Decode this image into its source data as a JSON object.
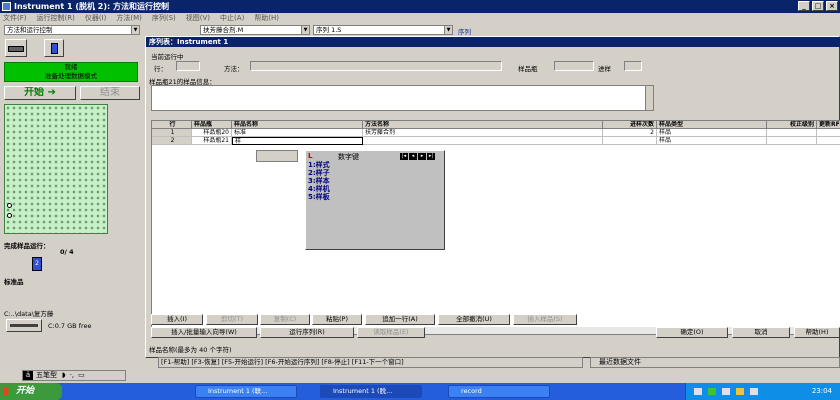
{
  "window": {
    "title": "Instrument 1 (脱机 2): 方法和运行控制",
    "controls": [
      "_",
      "□",
      "×"
    ]
  },
  "menu": [
    "文件(F)",
    "运行控制(R)",
    "仪器(I)",
    "方法(M)",
    "序列(S)",
    "视图(V)",
    "中止(A)",
    "帮助(H)"
  ],
  "toolbar": {
    "mode_select": "方法和运行控制",
    "method_select": "扶芳藤合剂.M",
    "sequence_select": "序列 1.S",
    "sequence_label": "序列"
  },
  "left_panel": {
    "status_line1": "就绪",
    "status_line2": "准备处理数据模式",
    "start_label": "开始",
    "stop_label": "结束",
    "completed_label": "完成样品运行：",
    "completed_count": "0/ 4",
    "vial_number": "2",
    "standard_label": "标准品",
    "path_label": "C:..\\data\\复方藤",
    "disk_free": "C:0.7 GB free"
  },
  "dialog": {
    "title": "序列表：Instrument 1",
    "current_label": "当前运行中",
    "row_label": "行：",
    "method_label": "方法：",
    "vial_label": "样品瓶",
    "inject_label": "进样",
    "info_label": "样品瓶21的样品信息：",
    "columns": [
      "行",
      "样品瓶",
      "样品名称",
      "方法名称",
      "进样次数",
      "样品类型",
      "校正级别",
      "更新RF"
    ],
    "rows": [
      [
        "1",
        "样品瓶20",
        "标准",
        "扶芳藤合剂",
        "2",
        "样品",
        "",
        ""
      ],
      [
        "2",
        "样品瓶21",
        "样",
        "",
        "",
        "样品",
        "",
        ""
      ]
    ],
    "ime": {
      "title": "数字键",
      "items": [
        "1:样式",
        "2:样子",
        "3:样本",
        "4:样机",
        "5:样板"
      ]
    },
    "buttons_row1": [
      "插入(I)",
      "剪切(T)",
      "复制(C)",
      "粘贴(P)",
      "追加一行(A)",
      "全部撤消(U)",
      "插入样品(S)"
    ],
    "buttons_row2": [
      "插入/批量输入向导(W)",
      "运行序列(R)",
      "读取样品(E)"
    ],
    "ok": "确定(O)",
    "cancel": "取消",
    "help": "帮助(H)",
    "status": "样品名称(最多为 40 个字符)"
  },
  "function_bar": "[F1-帮助] [F3-恢复] [F5-开始运行] [F6-开始运行序列] [F8-停止] [F11-下一个窗口]",
  "recent_files": "最近数据文件",
  "taskbar": {
    "start": "开始",
    "ime_bar": "五笔型",
    "items": [
      "Instrument 1 (联...",
      "Instrument 1 (脱...",
      "record"
    ],
    "time": "23:04"
  },
  "colors": {
    "title": "#0a246a",
    "status_green": "#00c000",
    "taskbar": "#245edc",
    "vial_blue": "#3050d0"
  }
}
